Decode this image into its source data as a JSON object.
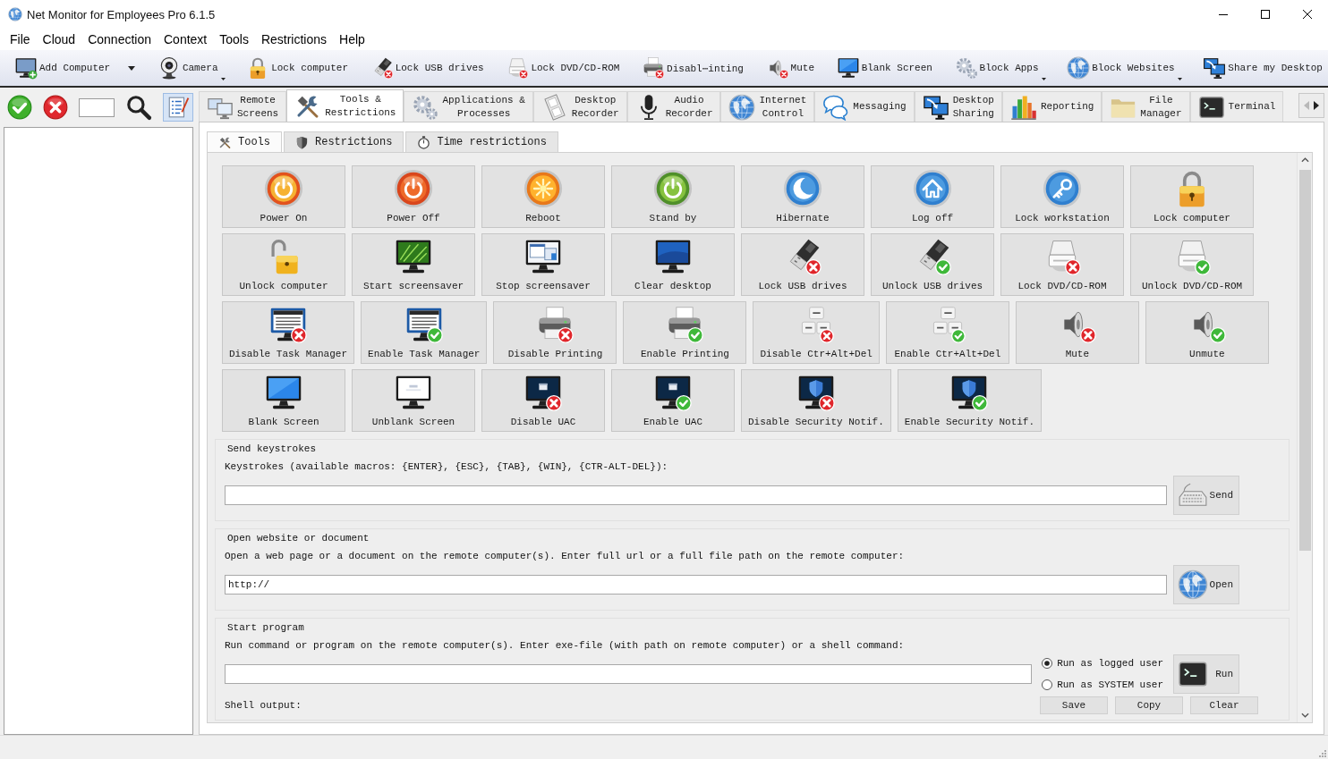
{
  "window": {
    "title": "Net Monitor for Employees Pro 6.1.5"
  },
  "menu": [
    "File",
    "Cloud",
    "Connection",
    "Context",
    "Tools",
    "Restrictions",
    "Help"
  ],
  "toolbar": [
    {
      "label": "Add Computer",
      "kind": "split"
    },
    {
      "label": "Camera",
      "kind": "menu"
    },
    {
      "label": "Lock computer",
      "kind": "plain"
    },
    {
      "label": "Lock USB drives",
      "kind": "plain"
    },
    {
      "label": "Lock DVD/CD-ROM",
      "kind": "plain"
    },
    {
      "label": "Disabl⋯inting",
      "kind": "plain"
    },
    {
      "label": "Mute",
      "kind": "plain"
    },
    {
      "label": "Blank Screen",
      "kind": "plain"
    },
    {
      "label": "Block Apps",
      "kind": "menu"
    },
    {
      "label": "Block Websites",
      "kind": "menu"
    },
    {
      "label": "Share my Desktop",
      "kind": "plain"
    }
  ],
  "left_toolbar": {
    "view_toggle": {
      "pressed": true
    }
  },
  "main_tabs": [
    {
      "label": "Remote\nScreens",
      "selected": false
    },
    {
      "label": "Tools &\nRestrictions",
      "selected": true
    },
    {
      "label": "Applications &\nProcesses",
      "selected": false
    },
    {
      "label": "Desktop\nRecorder",
      "selected": false
    },
    {
      "label": "Audio\nRecorder",
      "selected": false
    },
    {
      "label": "Internet\nControl",
      "selected": false
    },
    {
      "label": "Messaging",
      "selected": false
    },
    {
      "label": "Desktop\nSharing",
      "selected": false
    },
    {
      "label": "Reporting",
      "selected": false
    },
    {
      "label": "File\nManager",
      "selected": false
    },
    {
      "label": "Terminal",
      "selected": false
    }
  ],
  "tab_scroll": {
    "left_enabled": false,
    "right_enabled": true
  },
  "sub_tabs": [
    {
      "label": "Tools",
      "selected": true
    },
    {
      "label": "Restrictions",
      "selected": false
    },
    {
      "label": "Time restrictions",
      "selected": false
    }
  ],
  "tool_rows": [
    [
      "Power On",
      "Power Off",
      "Reboot",
      "Stand by",
      "Hibernate",
      "Log off",
      "Lock workstation",
      "Lock computer"
    ],
    [
      "Unlock computer",
      "Start screensaver",
      "Stop screensaver",
      "Clear desktop",
      "Lock USB drives",
      "Unlock USB drives",
      "Lock DVD/CD-ROM",
      "Unlock DVD/CD-ROM"
    ],
    [
      "Disable Task Manager",
      "Enable Task Manager",
      "Disable Printing",
      "Enable Printing",
      "Disable Ctr+Alt+Del",
      "Enable Ctr+Alt+Del",
      "Mute",
      "Unmute"
    ],
    [
      "Blank Screen",
      "Unblank Screen",
      "Disable UAC",
      "Enable UAC",
      "Disable Security Notif.",
      "Enable Security Notif."
    ]
  ],
  "send_keystrokes": {
    "title": "Send keystrokes",
    "hint": "Keystrokes (available macros: {ENTER}, {ESC}, {TAB}, {WIN}, {CTR-ALT-DEL}):",
    "button": "Send"
  },
  "open_website": {
    "title": "Open website or document",
    "hint": "Open a web page or a document on the remote computer(s). Enter full url or a full file path on the remote computer:",
    "value": "http://",
    "button": "Open"
  },
  "start_program": {
    "title": "Start program",
    "hint": "Run command or program on the remote computer(s). Enter exe-file (with path on remote computer) or a shell command:",
    "options": [
      {
        "label": "Run as logged user",
        "selected": true
      },
      {
        "label": "Run as SYSTEM user",
        "selected": false
      }
    ],
    "button": "Run",
    "output_label": "Shell output:",
    "output_buttons": [
      "Save",
      "Copy",
      "Clear"
    ]
  }
}
